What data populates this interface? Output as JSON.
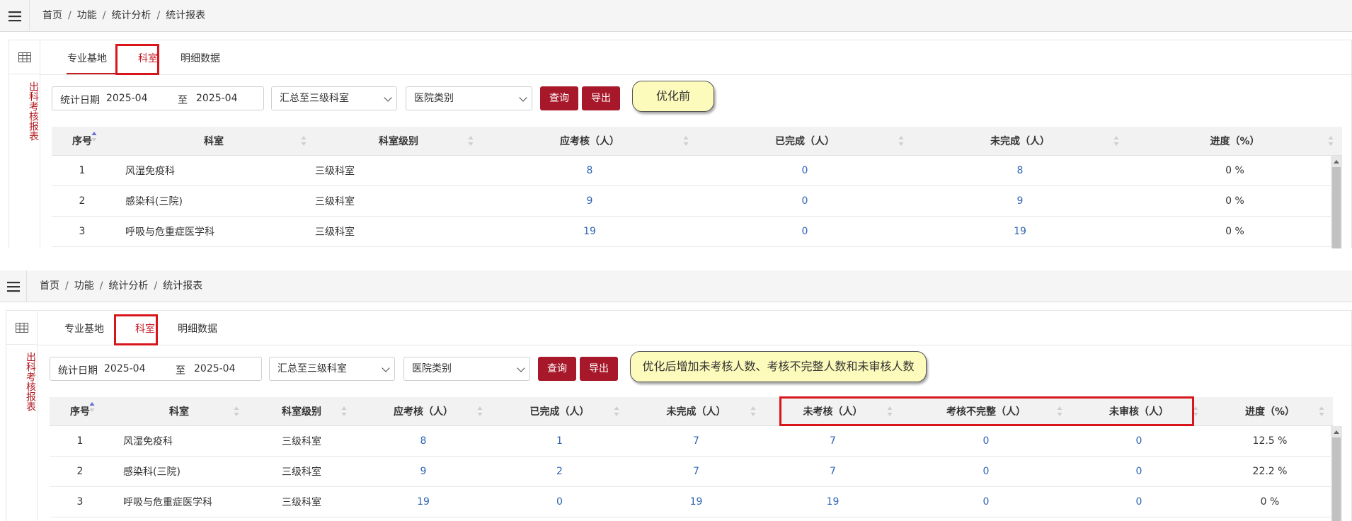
{
  "header": {
    "breadcrumbs": [
      "首页",
      "功能",
      "统计分析",
      "统计报表"
    ]
  },
  "side_title": "出科考核报表",
  "tabs": [
    "专业基地",
    "科室",
    "明细数据"
  ],
  "active_tab": "科室",
  "filters": {
    "date_label": "统计日期",
    "date_from": "2025-04",
    "date_to_label": "至",
    "date_to": "2025-04",
    "level_select": "汇总至三级科室",
    "hospital_select": "医院类别",
    "query_button": "查询",
    "export_button": "导出"
  },
  "colors": {
    "accent": "#a6182a",
    "link": "#2e64b4",
    "highlight_border": "#d9151c",
    "callout_bg": "#fdfbbb"
  },
  "before": {
    "callout": "优化前",
    "columns": [
      "序号",
      "科室",
      "科室级别",
      "应考核（人）",
      "已完成（人）",
      "未完成（人）",
      "进度（%）"
    ],
    "rows": [
      [
        "1",
        "风湿免疫科",
        "三级科室",
        "8",
        "0",
        "8",
        "0 %"
      ],
      [
        "2",
        "感染科(三院)",
        "三级科室",
        "9",
        "0",
        "9",
        "0 %"
      ],
      [
        "3",
        "呼吸与危重症医学科",
        "三级科室",
        "19",
        "0",
        "19",
        "0 %"
      ]
    ]
  },
  "after": {
    "callout": "优化后增加未考核人数、考核不完整人数和未审核人数",
    "columns": [
      "序号",
      "科室",
      "科室级别",
      "应考核（人）",
      "已完成（人）",
      "未完成（人）",
      "未考核（人）",
      "考核不完整（人）",
      "未审核（人）",
      "进度（%）"
    ],
    "rows": [
      [
        "1",
        "风湿免疫科",
        "三级科室",
        "8",
        "1",
        "7",
        "7",
        "0",
        "0",
        "12.5 %"
      ],
      [
        "2",
        "感染科(三院)",
        "三级科室",
        "9",
        "2",
        "7",
        "7",
        "0",
        "0",
        "22.2 %"
      ],
      [
        "3",
        "呼吸与危重症医学科",
        "三级科室",
        "19",
        "0",
        "19",
        "19",
        "0",
        "0",
        "0 %"
      ]
    ]
  }
}
